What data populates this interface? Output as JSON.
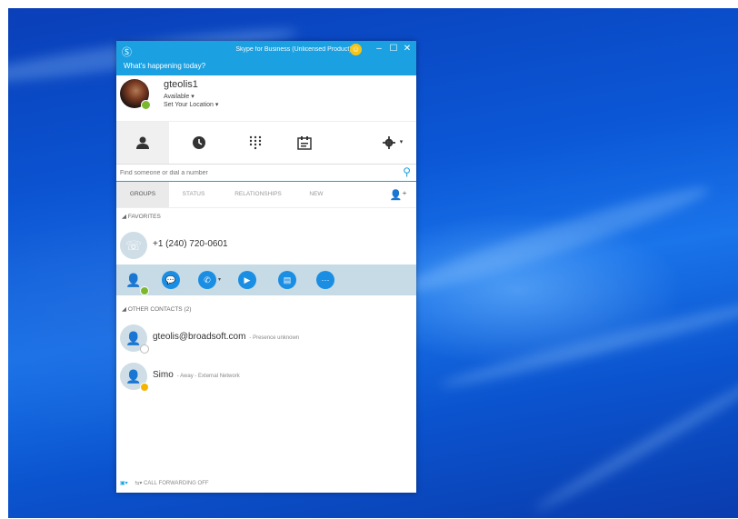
{
  "window": {
    "title": "Skype for Business (Unlicensed Product)",
    "mood_prompt": "What's happening today?"
  },
  "profile": {
    "name": "gteolis1",
    "status": "Available",
    "location": "Set Your Location"
  },
  "search": {
    "placeholder": "Find someone or dial a number"
  },
  "subtabs": [
    "GROUPS",
    "STATUS",
    "RELATIONSHIPS",
    "NEW"
  ],
  "favorites": {
    "header": "FAVORITES",
    "items": [
      {
        "name": "+1 (240) 720-0601"
      }
    ]
  },
  "other_contacts": {
    "header": "OTHER CONTACTS (2)",
    "items": [
      {
        "name": "gteolis@broadsoft.com",
        "note": "- Presence unknown"
      },
      {
        "name": "Simo",
        "note": "- Away - External Network"
      }
    ]
  },
  "statusbar": {
    "forwarding": "CALL FORWARDING OFF"
  },
  "colors": {
    "accent": "#1ba1e2",
    "action_button": "#1a8ee3",
    "available": "#7cb82f",
    "away": "#f5b400"
  }
}
